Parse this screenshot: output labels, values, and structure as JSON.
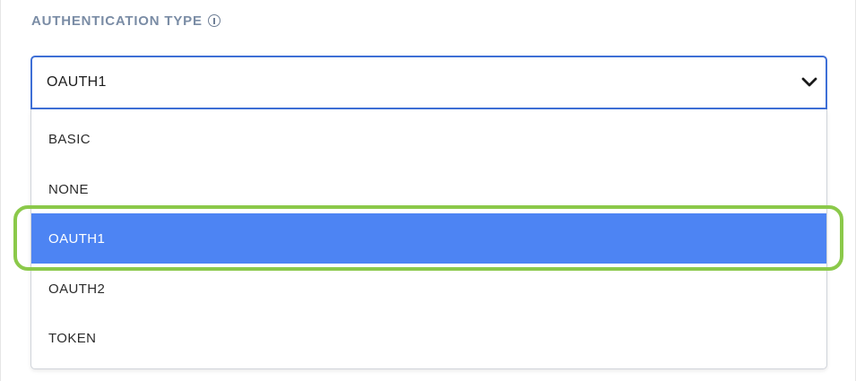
{
  "field": {
    "label": "AUTHENTICATION TYPE",
    "icon": "info-icon"
  },
  "select": {
    "value": "OAUTH1",
    "icon": "chevron-down-icon"
  },
  "options": [
    {
      "label": "BASIC",
      "selected": false
    },
    {
      "label": "NONE",
      "selected": false
    },
    {
      "label": "OAUTH1",
      "selected": true
    },
    {
      "label": "OAUTH2",
      "selected": false
    },
    {
      "label": "TOKEN",
      "selected": false
    }
  ],
  "colors": {
    "label": "#7a8ca5",
    "select_border": "#3e6fd6",
    "selected_bg": "#4d84f3",
    "highlight_ring": "#8bc94a"
  }
}
